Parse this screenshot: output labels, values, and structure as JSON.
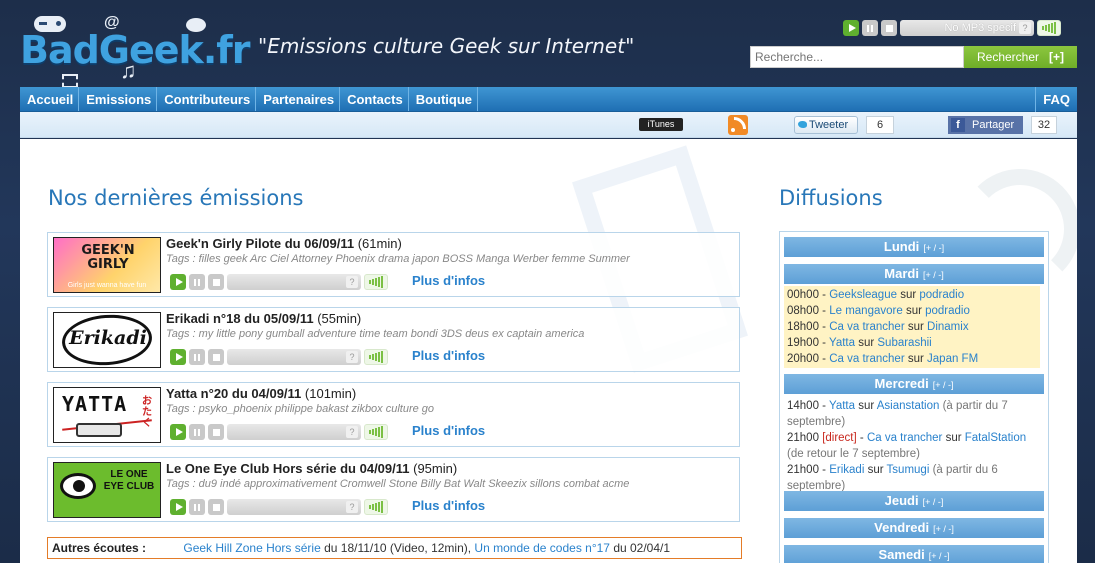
{
  "header": {
    "logo_text": "BadGeek.fr",
    "slogan": "\"Emissions culture Geek sur Internet\"",
    "player_track": "No MP3 specif",
    "search_placeholder": "Recherche...",
    "search_button": "Rechercher",
    "search_plus": "[+]"
  },
  "nav": {
    "items": [
      "Accueil",
      "Emissions",
      "Contributeurs",
      "Partenaires",
      "Contacts",
      "Boutique"
    ],
    "faq": "FAQ"
  },
  "social": {
    "itunes": "iTunes",
    "tweet": "Tweeter",
    "tweet_count": "6",
    "share": "Partager",
    "share_count": "32"
  },
  "latest": {
    "title": "Nos dernières émissions",
    "more_label": "Plus d'infos",
    "episodes": [
      {
        "name": "Geek'n Girly Pilote du 06/09/11",
        "duration": "(61min)",
        "tags": "Tags : filles geek Arc Ciel Attorney Phoenix drama japon BOSS Manga Werber femme Summer",
        "thumb_main": "GEEK'N GIRLY",
        "thumb_sub": "Girls just wanna have fun"
      },
      {
        "name": "Erikadi n°18 du 05/09/11",
        "duration": "(55min)",
        "tags": "Tags : my little pony gumball adventure time team bondi 3DS deus ex captain america",
        "thumb_main": "Erikadi"
      },
      {
        "name": "Yatta n°20 du 04/09/11",
        "duration": "(101min)",
        "tags": "Tags : psyko_phoenix philippe bakast zikbox culture go",
        "thumb_main": "YATTA",
        "thumb_sub": "おたく"
      },
      {
        "name": "Le One Eye Club Hors série du 04/09/11",
        "duration": "(95min)",
        "tags": "Tags : du9 indé approximativement Cromwell Stone Billy Bat Walt Skeezix sillons combat acme",
        "thumb_main": "LE ONE EYE CLUB"
      }
    ]
  },
  "autres": {
    "label": "Autres écoutes :",
    "link1": "Geek Hill Zone Hors série",
    "text1": " du 18/11/10 (Video, 12min), ",
    "link2": "Un monde de codes n°17",
    "text2": " du 02/04/1"
  },
  "diffusions": {
    "title": "Diffusions",
    "toggle": "[+ / -]",
    "days": [
      "Lundi",
      "Mardi",
      "Mercredi",
      "Jeudi",
      "Vendredi",
      "Samedi"
    ],
    "sur": " sur ",
    "mardi": [
      {
        "time": "00h00",
        "show": "Geeksleague",
        "radio": "podradio"
      },
      {
        "time": "08h00",
        "show": "Le mangavore",
        "radio": "podradio"
      },
      {
        "time": "18h00",
        "show": "Ca va trancher",
        "radio": "Dinamix"
      },
      {
        "time": "19h00",
        "show": "Yatta",
        "radio": "Subarashii"
      },
      {
        "time": "20h00",
        "show": "Ca va trancher",
        "radio": "Japan FM"
      }
    ],
    "mercredi": [
      {
        "time": "14h00",
        "show": "Yatta",
        "radio": "Asianstation",
        "note": "(à partir du 7 septembre)"
      },
      {
        "time": "21h00",
        "flag": "[direct]",
        "show": "Ca va trancher",
        "radio": "FatalStation",
        "note": "(de retour le 7 septembre)"
      },
      {
        "time": "21h00",
        "show": "Erikadi",
        "radio": "Tsumugi",
        "note": "(à partir du 6 septembre)"
      }
    ]
  },
  "colors": {
    "accent_blue": "#2877b8",
    "nav_blue": "#1f6fb3",
    "green": "#6fae28",
    "orange_border": "#e47c28"
  }
}
